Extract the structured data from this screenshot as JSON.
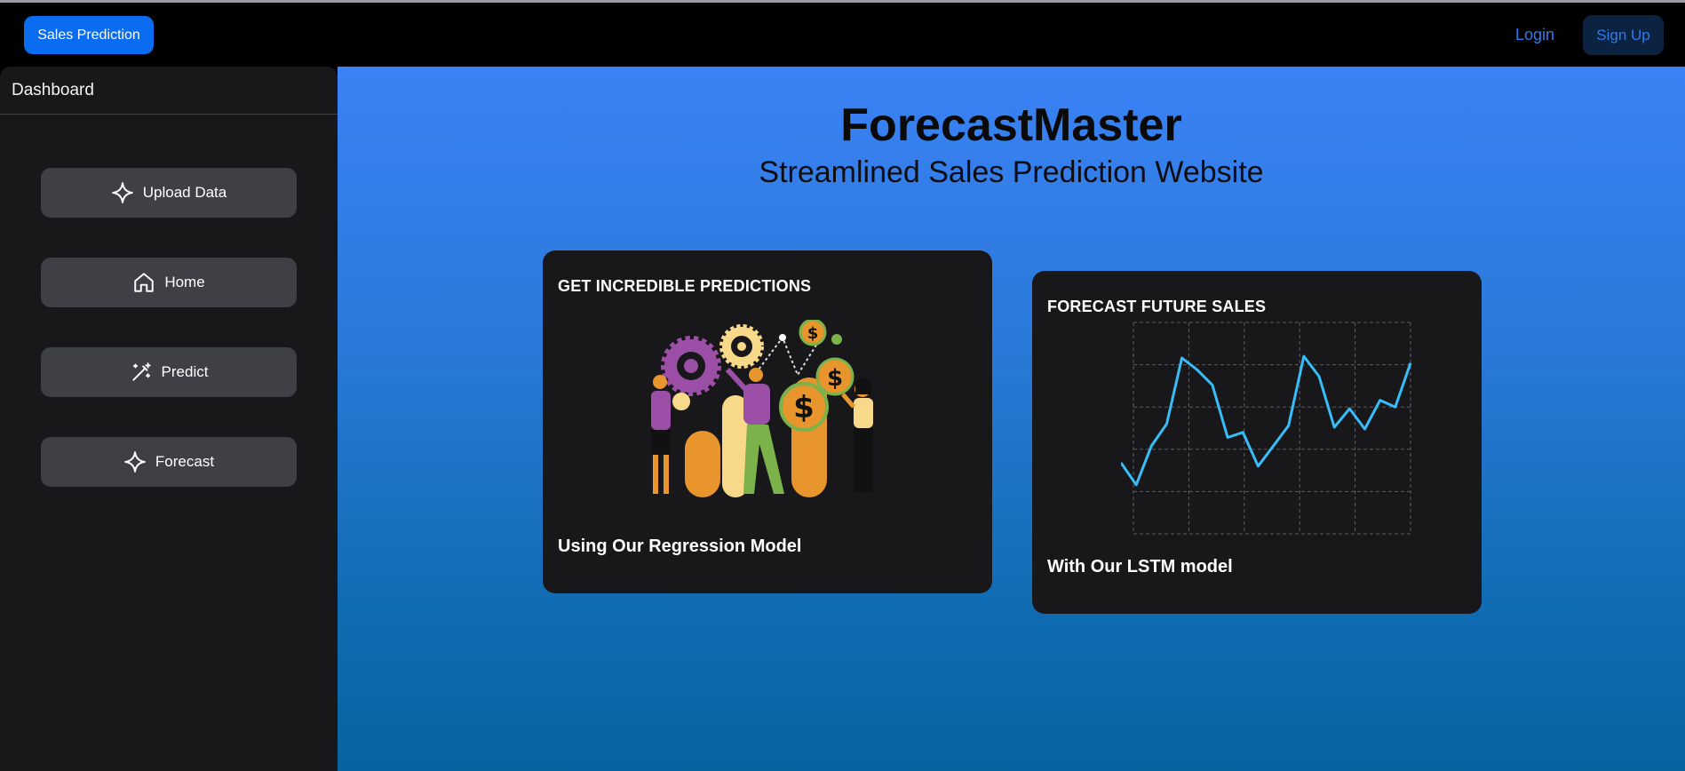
{
  "navbar": {
    "brand_label": "Sales Prediction",
    "login_label": "Login",
    "signup_label": "Sign Up"
  },
  "sidebar": {
    "title": "Dashboard",
    "items": [
      {
        "label": "Upload Data",
        "icon": "sparkle-icon"
      },
      {
        "label": "Home",
        "icon": "home-icon"
      },
      {
        "label": "Predict",
        "icon": "magic-wand-icon"
      },
      {
        "label": "Forecast",
        "icon": "sparkle-icon"
      }
    ]
  },
  "hero": {
    "title": "ForecastMaster",
    "subtitle": "Streamlined Sales Prediction Website"
  },
  "cards": [
    {
      "title": "GET INCREDIBLE PREDICTIONS",
      "caption": "Using Our Regression Model",
      "image": "people-with-gears-and-dollar-coins-illustration"
    },
    {
      "title": "FORECAST FUTURE SALES",
      "caption": "With Our LSTM model"
    }
  ],
  "chart_data": {
    "type": "line",
    "title": "",
    "xlabel": "",
    "ylabel": "",
    "grid": true,
    "line_color": "#38bdf8",
    "values": [
      42,
      29,
      52,
      65,
      104,
      97,
      88,
      57,
      60,
      40,
      52,
      64,
      105,
      93,
      63,
      74,
      62,
      79,
      75,
      101
    ],
    "ylim": [
      0,
      125
    ]
  },
  "colors": {
    "brand": "#0a6cf0",
    "sidebar_bg": "#18181b",
    "button_bg": "#3f3f46",
    "main_gradient_top": "#3b82f6",
    "main_gradient_bottom": "#07649f"
  }
}
